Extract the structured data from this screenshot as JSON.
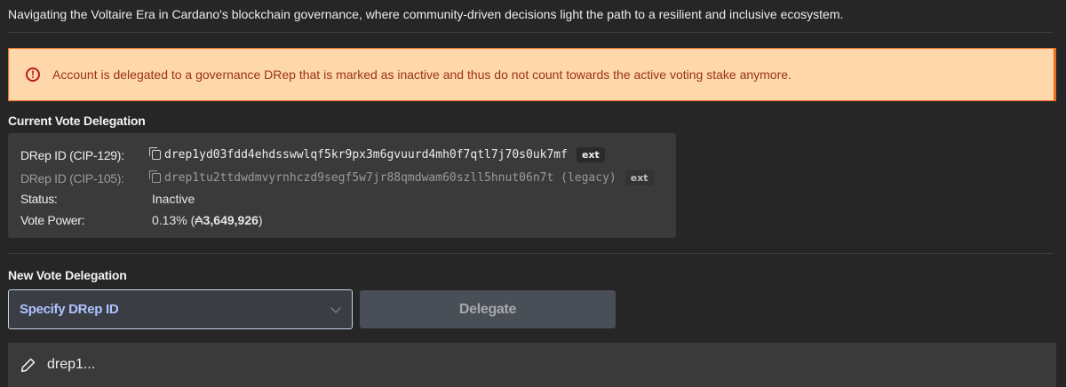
{
  "intro": "Navigating the Voltaire Era in Cardano's blockchain governance, where community-driven decisions light the path to a resilient and inclusive ecosystem.",
  "warning": {
    "icon": "alert-circle-icon",
    "text": "Account is delegated to a governance DRep that is marked as inactive and thus do not count towards the active voting stake anymore.",
    "bg_color": "#fed7aa",
    "border_color": "#f26d1f"
  },
  "current": {
    "title": "Current Vote Delegation",
    "rows": {
      "cip129": {
        "label": "DRep ID (CIP-129):",
        "value": "drep1yd03fdd4ehdsswwlqf5kr9px3m6gvuurd4mh0f7qtl7j70s0uk7mf",
        "tag": "ext"
      },
      "cip105": {
        "label": "DRep ID (CIP-105):",
        "value": "drep1tu2ttdwdmvyrnhczd9segf5w7jr88qmdwam60szll5hnut06n7t (legacy)",
        "tag": "ext"
      },
      "status": {
        "label": "Status:",
        "value": "Inactive"
      },
      "power": {
        "label": "Vote Power:",
        "percent": "0.13%",
        "open": " (",
        "symbol": "₳",
        "amount": "3,649,926",
        "close": ")"
      }
    }
  },
  "new": {
    "title": "New Vote Delegation",
    "select_value": "Specify DRep ID",
    "delegate_label": "Delegate",
    "input_value": "drep1..."
  },
  "colors": {
    "background": "#262626",
    "accent": "#aec3ff"
  }
}
